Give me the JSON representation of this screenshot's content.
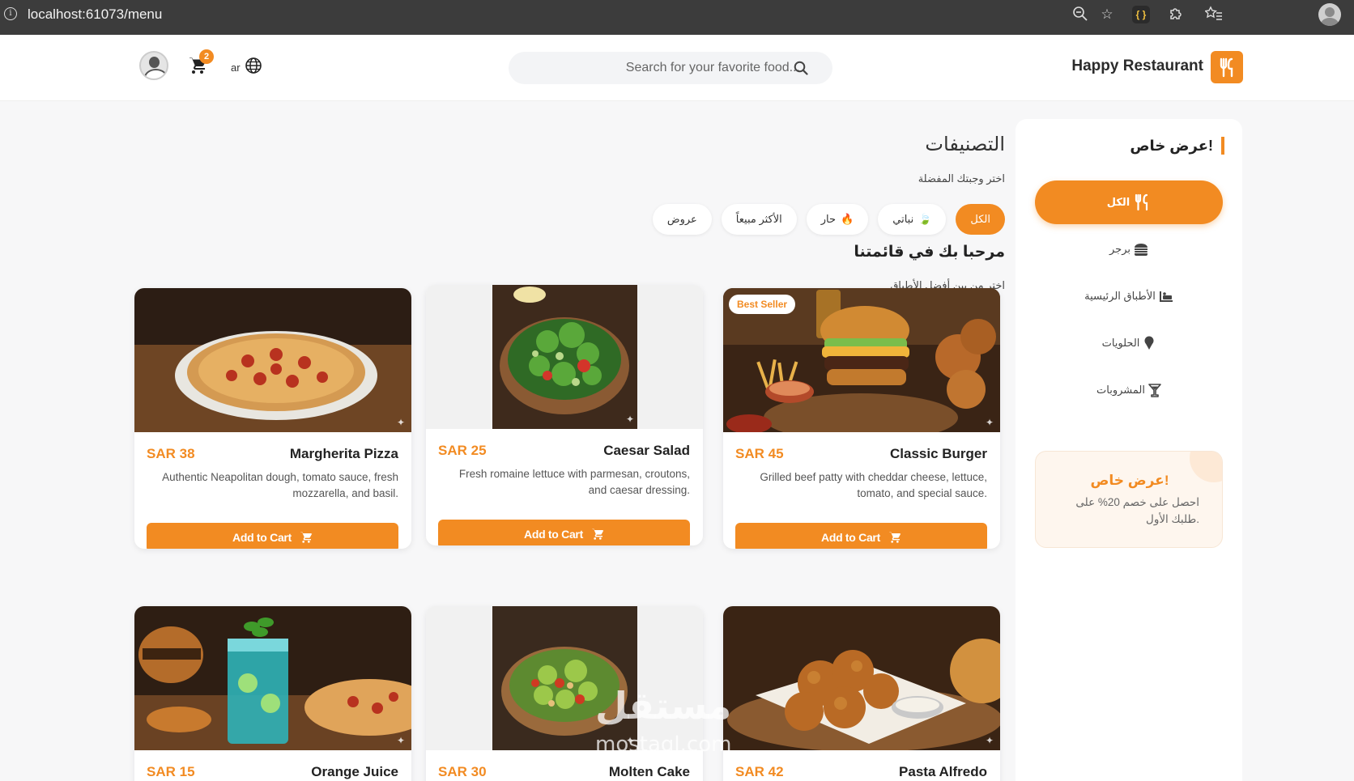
{
  "browser": {
    "url": "localhost:61073/menu"
  },
  "header": {
    "brand_name": "Happy Restaurant",
    "search_placeholder": "Search for your favorite food...",
    "cart_count": "2",
    "language": "ar"
  },
  "sidebar": {
    "offer_heading": "عرض خاص!",
    "items": [
      {
        "label": "الكل",
        "icon": "utensils-icon",
        "active": true
      },
      {
        "label": "برجر",
        "icon": "burger-icon",
        "active": false
      },
      {
        "label": "الأطباق الرئيسية",
        "icon": "plate-icon",
        "active": false
      },
      {
        "label": "الحلويات",
        "icon": "ice-cream-icon",
        "active": false
      },
      {
        "label": "المشروبات",
        "icon": "cocktail-icon",
        "active": false
      }
    ],
    "promo": {
      "title": "عرض خاص!",
      "text": "احصل على خصم 20% على طلبك الأول."
    }
  },
  "main": {
    "categories_title": "التصنيفات",
    "categories_subtitle": "اختر وجبتك المفضلة",
    "filters": [
      {
        "label": "الكل",
        "icon": "",
        "active": true
      },
      {
        "label": "نباتي",
        "icon": "leaf-icon",
        "active": false
      },
      {
        "label": "حار",
        "icon": "fire-icon",
        "active": false
      },
      {
        "label": "الأكثر مبيعاً",
        "icon": "",
        "active": false
      },
      {
        "label": "عروض",
        "icon": "",
        "active": false
      }
    ],
    "welcome_title": "مرحبا بك في قائمتنا",
    "welcome_subtitle": "اختر من بين أفضل الأطباق",
    "best_seller_badge": "Best Seller",
    "add_to_cart_label": "Add to Cart",
    "products": [
      {
        "name": "Classic Burger",
        "price": "SAR 45",
        "description": "Grilled beef patty with cheddar cheese, lettuce, tomato, and special sauce.",
        "image": "burger-photo"
      },
      {
        "name": "Caesar Salad",
        "price": "SAR 25",
        "description": "Fresh romaine lettuce with parmesan, croutons, and caesar dressing.",
        "image": "salad-photo"
      },
      {
        "name": "Margherita Pizza",
        "price": "SAR 38",
        "description": "Authentic Neapolitan dough, tomato sauce, fresh mozzarella, and basil.",
        "image": "pizza-photo"
      },
      {
        "name": "Pasta Alfredo",
        "price": "SAR 42",
        "description": "",
        "image": "fried-chicken-photo"
      },
      {
        "name": "Molten Cake",
        "price": "SAR 30",
        "description": "",
        "image": "salad-bowl-photo"
      },
      {
        "name": "Orange Juice",
        "price": "SAR 15",
        "description": "",
        "image": "juice-photo"
      }
    ]
  },
  "watermark": {
    "arabic": "مستقل",
    "latin": "mostaql.com"
  },
  "colors": {
    "accent": "#f28b22",
    "page_bg": "#f7f7f8",
    "chrome_bg": "#3c3c3c"
  }
}
